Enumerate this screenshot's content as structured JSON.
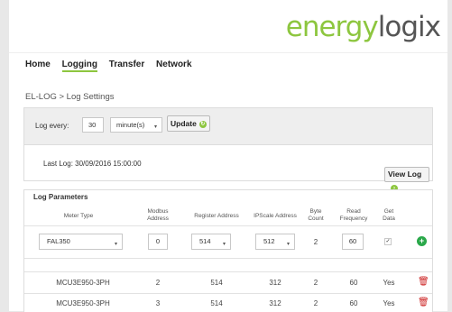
{
  "logo": {
    "part1": "energy",
    "part2": "logix"
  },
  "nav": [
    "Home",
    "Logging",
    "Transfer",
    "Network"
  ],
  "breadcrumb": "EL-LOG > Log Settings",
  "log_settings": {
    "log_every_label": "Log every:",
    "interval_value": "30",
    "unit_value": "minute(s)",
    "update_label": "Update",
    "last_log": "Last Log: 30/09/2016 15:00:00",
    "view_log_label": "View Log"
  },
  "params": {
    "title": "Log Parameters",
    "headers": [
      "Meter Type",
      "Modbus Address",
      "Register Address",
      "IPScale Address",
      "Byte Count",
      "Read Frequency",
      "Get Data"
    ],
    "new_row": {
      "meter_type": "FAL350",
      "modbus": "0",
      "register": "514",
      "ipscale": "512",
      "bytes": "2",
      "freq": "60"
    },
    "rows": [
      {
        "meter": "MCU3E950-3PH",
        "modbus": "2",
        "register": "514",
        "ipscale": "312",
        "bytes": "2",
        "freq": "60",
        "get": "Yes"
      },
      {
        "meter": "MCU3E950-3PH",
        "modbus": "3",
        "register": "514",
        "ipscale": "312",
        "bytes": "2",
        "freq": "60",
        "get": "Yes"
      }
    ]
  }
}
